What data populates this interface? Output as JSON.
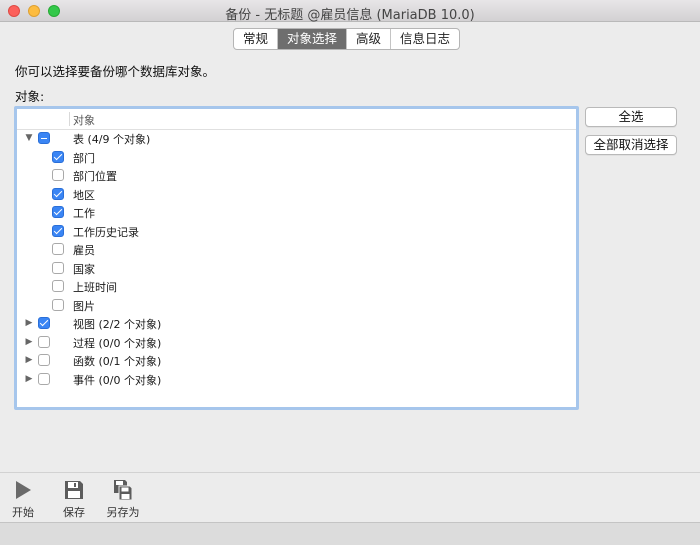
{
  "window": {
    "title": "备份 - 无标题 @雇员信息 (MariaDB 10.0)"
  },
  "tabs": [
    {
      "label": "常规",
      "active": false
    },
    {
      "label": "对象选择",
      "active": true
    },
    {
      "label": "高级",
      "active": false
    },
    {
      "label": "信息日志",
      "active": false
    }
  ],
  "intro": "你可以选择要备份哪个数据库对象。",
  "objects_label": "对象:",
  "tree": {
    "column_header": "对象",
    "rows": [
      {
        "label": "表 (4/9 个对象)",
        "level": 0,
        "expanded": true,
        "state": "mixed"
      },
      {
        "label": "部门",
        "level": 1,
        "state": "checked"
      },
      {
        "label": "部门位置",
        "level": 1,
        "state": "unchecked"
      },
      {
        "label": "地区",
        "level": 1,
        "state": "checked"
      },
      {
        "label": "工作",
        "level": 1,
        "state": "checked"
      },
      {
        "label": "工作历史记录",
        "level": 1,
        "state": "checked"
      },
      {
        "label": "雇员",
        "level": 1,
        "state": "unchecked"
      },
      {
        "label": "国家",
        "level": 1,
        "state": "unchecked"
      },
      {
        "label": "上班时间",
        "level": 1,
        "state": "unchecked"
      },
      {
        "label": "图片",
        "level": 1,
        "state": "unchecked"
      },
      {
        "label": "视图 (2/2 个对象)",
        "level": 0,
        "expanded": false,
        "state": "checked"
      },
      {
        "label": "过程 (0/0 个对象)",
        "level": 0,
        "expanded": false,
        "state": "unchecked"
      },
      {
        "label": "函数 (0/1 个对象)",
        "level": 0,
        "expanded": false,
        "state": "unchecked"
      },
      {
        "label": "事件 (0/0 个对象)",
        "level": 0,
        "expanded": false,
        "state": "unchecked"
      }
    ]
  },
  "buttons": {
    "select_all": "全选",
    "deselect_all": "全部取消选择"
  },
  "toolbar": [
    {
      "label": "开始",
      "icon": "play-icon"
    },
    {
      "label": "保存",
      "icon": "save-icon"
    },
    {
      "label": "另存为",
      "icon": "save-as-icon"
    }
  ],
  "colors": {
    "checkbox_checked": "#3a85f4",
    "tab_active": "#6e6e6e",
    "focus_ring": "#a6c6ec"
  }
}
